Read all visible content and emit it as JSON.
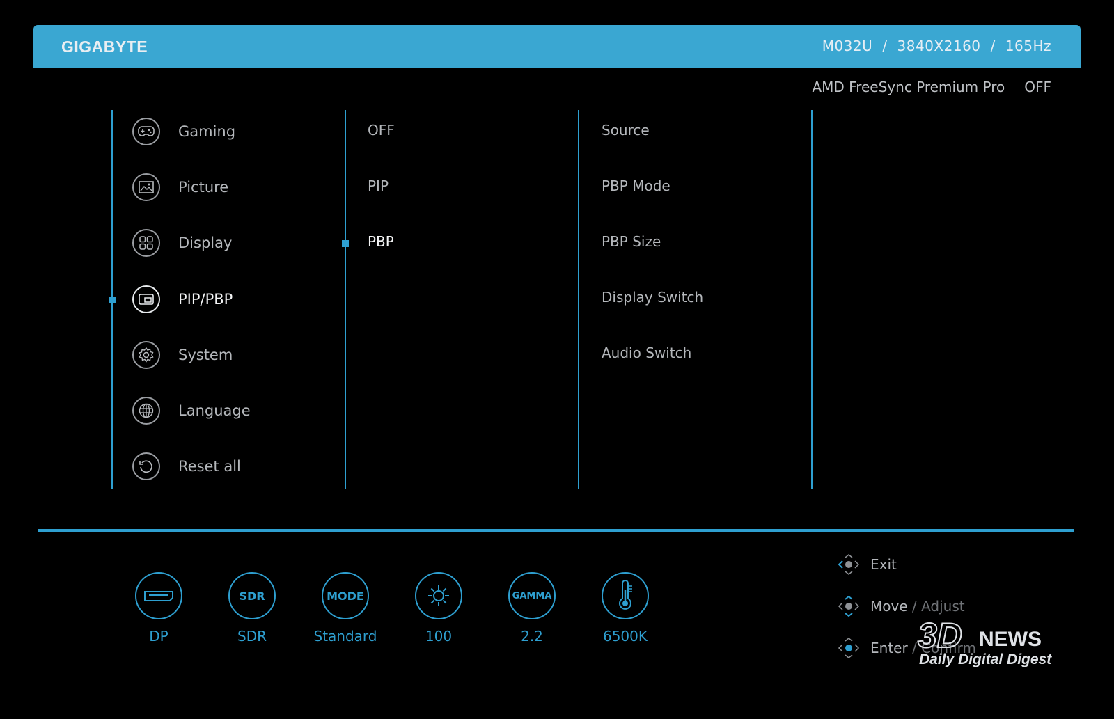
{
  "header": {
    "brand": "GIGABYTE",
    "model": "M032U",
    "resolution": "3840X2160",
    "refresh": "165Hz",
    "separator": "/"
  },
  "status": {
    "freesync_label": "AMD FreeSync Premium Pro",
    "freesync_value": "OFF"
  },
  "main_menu": {
    "items": [
      {
        "label": "Gaming",
        "icon": "gamepad-icon"
      },
      {
        "label": "Picture",
        "icon": "picture-icon"
      },
      {
        "label": "Display",
        "icon": "display-grid-icon"
      },
      {
        "label": "PIP/PBP",
        "icon": "pip-pbp-icon",
        "selected": true
      },
      {
        "label": "System",
        "icon": "gear-icon"
      },
      {
        "label": "Language",
        "icon": "globe-icon"
      },
      {
        "label": "Reset all",
        "icon": "reset-icon"
      }
    ]
  },
  "sub_menu": {
    "items": [
      {
        "label": "OFF"
      },
      {
        "label": "PIP"
      },
      {
        "label": "PBP",
        "selected": true
      }
    ]
  },
  "options": {
    "items": [
      {
        "label": "Source"
      },
      {
        "label": "PBP Mode"
      },
      {
        "label": "PBP Size"
      },
      {
        "label": "Display Switch"
      },
      {
        "label": "Audio Switch"
      }
    ]
  },
  "quick_info": [
    {
      "icon": "displayport-icon",
      "icon_text": "",
      "value": "DP"
    },
    {
      "icon": "sdr-icon",
      "icon_text": "SDR",
      "value": "SDR"
    },
    {
      "icon": "mode-icon",
      "icon_text": "MODE",
      "value": "Standard"
    },
    {
      "icon": "brightness-icon",
      "icon_text": "",
      "value": "100"
    },
    {
      "icon": "gamma-icon",
      "icon_text": "GAMMA",
      "value": "2.2"
    },
    {
      "icon": "thermometer-icon",
      "icon_text": "",
      "value": "6500K"
    }
  ],
  "help": {
    "exit": "Exit",
    "move": "Move",
    "move_sep": " / ",
    "adjust": "Adjust",
    "enter": "Enter",
    "enter_sep": " / ",
    "confirm": "Confirm"
  },
  "watermark": {
    "logo_3d": "3D",
    "logo_news": "NEWS",
    "tagline": "Daily Digital Digest"
  },
  "colors": {
    "accent": "#2e9fd0",
    "header_bar": "#3aa7d2",
    "background": "#000000",
    "text": "#b4b7bb",
    "text_active": "#f4f5f6"
  }
}
